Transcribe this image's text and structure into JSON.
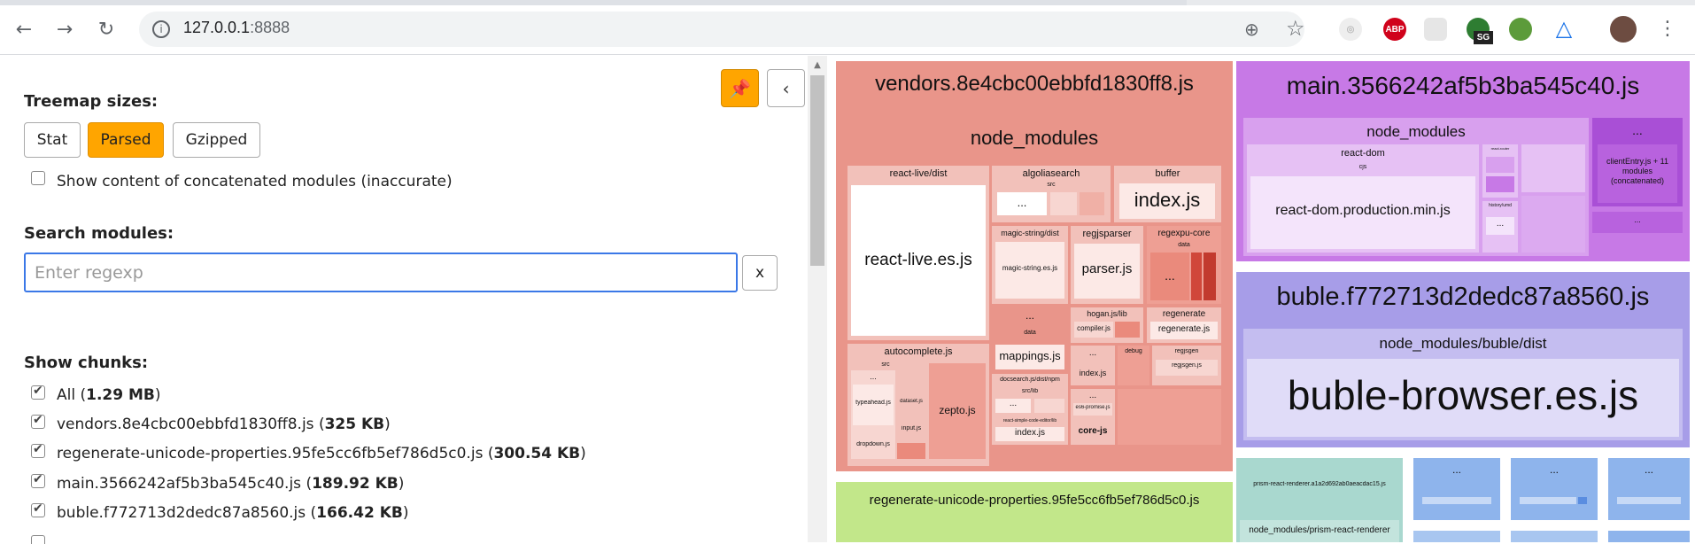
{
  "browser": {
    "url_host": "127.0.0.1",
    "url_port": ":8888",
    "extensions": [
      "adblock-icon",
      "sg-extension-icon",
      "globe-extension-icon",
      "triangle-extension-icon"
    ],
    "ext_abp_label": "ABP",
    "ext_sg_label": "SG"
  },
  "sidebar": {
    "treemap_sizes_label": "Treemap sizes:",
    "size_buttons": [
      "Stat",
      "Parsed",
      "Gzipped"
    ],
    "active_size": "Parsed",
    "concat_checkbox_label": "Show content of concatenated modules (inaccurate)",
    "search_label": "Search modules:",
    "search_placeholder": "Enter regexp",
    "clear_button": "x",
    "show_chunks_label": "Show chunks:",
    "chunks": [
      {
        "name": "All",
        "size": "1.29 MB",
        "checked": true
      },
      {
        "name": "vendors.8e4cbc00ebbfd1830ff8.js",
        "size": "325 KB",
        "checked": true
      },
      {
        "name": "regenerate-unicode-properties.95fe5cc6fb5ef786d5c0.js",
        "size": "300.54 KB",
        "checked": true
      },
      {
        "name": "main.3566242af5b3ba545c40.js",
        "size": "189.92 KB",
        "checked": true
      },
      {
        "name": "buble.f772713d2dedc87a8560.js",
        "size": "166.42 KB",
        "checked": true
      }
    ]
  },
  "treemap": {
    "vendors": {
      "title": "vendors.8e4cbc00ebbfd1830ff8.js",
      "node_modules": "node_modules",
      "react_live_dist": "react-live/dist",
      "react_live_file": "react-live.es.js",
      "algoliasearch": "algoliasearch",
      "algolia_src": "src",
      "ellipsis": "...",
      "buffer": "buffer",
      "buffer_index": "index.js",
      "magic_string_dist": "magic-string/dist",
      "magic_string_file": "magic-string.es.js",
      "regjsparser": "regjsparser",
      "regjsparser_file": "parser.js",
      "regexpu_core": "regexpu-core",
      "regexpu_data": "data",
      "data_label": "data",
      "mappings": "mappings.js",
      "hogan": "hogan.js/lib",
      "compiler": "compiler.js",
      "regenerate": "regenerate",
      "regenerate_file": "regenerate.js",
      "debug": "debug",
      "regjsgen": "regjsgen",
      "regjsgen_file": "regjsgen.js",
      "index_js": "index.js",
      "docsearch": "docsearch.js/dist/npm",
      "docsearch_src": "src/lib",
      "react_simple": "react-simple-code-editor/lib",
      "docsearch_index": "index.js",
      "es6_promise": "es6-promise.js",
      "core_js": "core-js",
      "autocomplete": "autocomplete.js",
      "autocomplete_src": "src",
      "typeahead": "typeahead.js",
      "dataset": "dataset.js",
      "input": "input.js",
      "dropdown": "dropdown.js",
      "zepto": "zepto.js"
    },
    "main": {
      "title": "main.3566242af5b3ba545c40.js",
      "node_modules": "node_modules",
      "react_dom": "react-dom",
      "cjs": "cjs",
      "react_dom_file": "react-dom.production.min.js",
      "react_router": "react-router",
      "history": "history/umd",
      "client_entry": "clientEntry.js + 11 modules (concatenated)",
      "ellipsis": "..."
    },
    "buble": {
      "title": "buble.f772713d2dedc87a8560.js",
      "node_modules": "node_modules/buble/dist",
      "file": "buble-browser.es.js"
    },
    "regenerate": {
      "title": "regenerate-unicode-properties.95fe5cc6fb5ef786d5c0.js"
    },
    "prism": {
      "title": "prism-react-renderer.a1a2d692ab0aeacdac15.js",
      "node_modules": "node_modules/prism-react-renderer"
    },
    "small_chunk_label": "..."
  },
  "colors": {
    "accent": "#ffa500",
    "vendors": "#e9958a",
    "main": "#c779e6",
    "buble": "#a79de8",
    "regenerate": "#c2e78a",
    "prism": "#a9d8cf",
    "small_chunks": "#8eb4ec"
  }
}
